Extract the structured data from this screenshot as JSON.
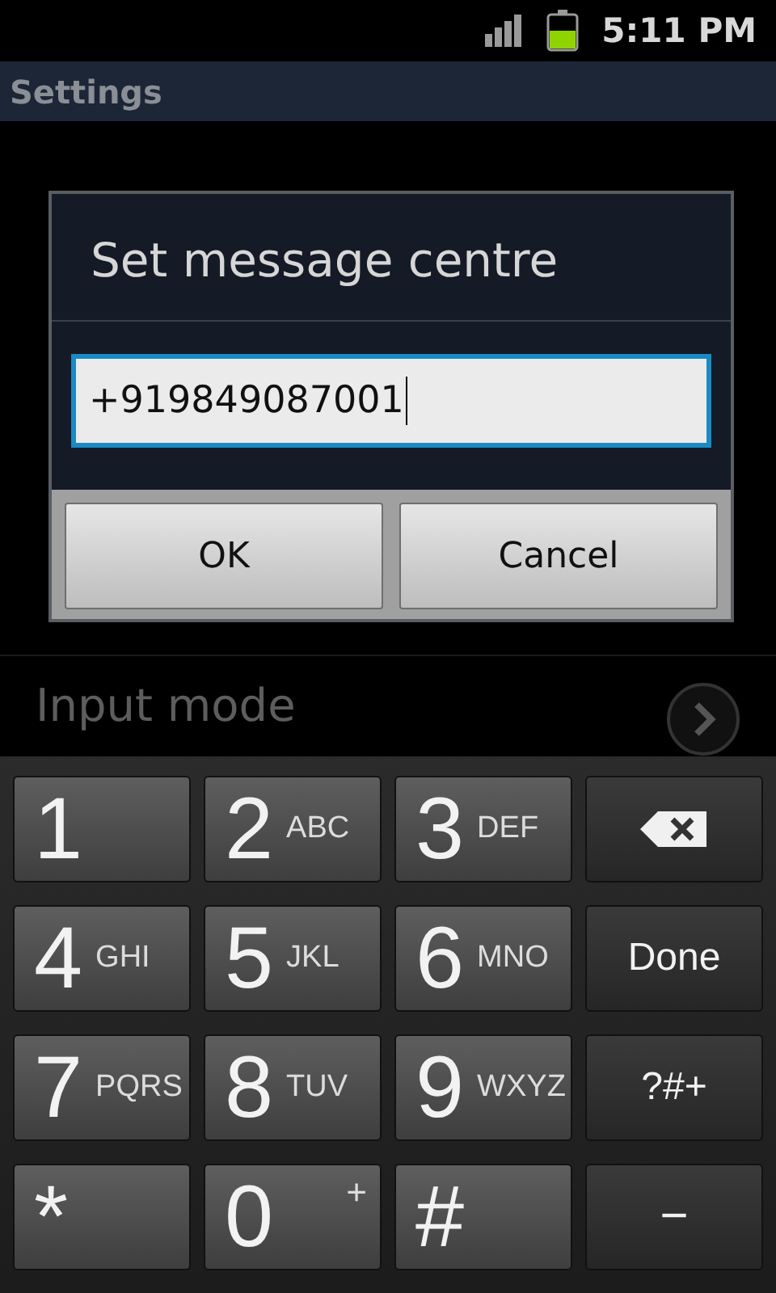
{
  "status_bar": {
    "time": "5:11 PM"
  },
  "title_bar": {
    "title": "Settings"
  },
  "settings_list": [
    {
      "title": "Input mode"
    }
  ],
  "dialog": {
    "title": "Set message centre",
    "field": {
      "value": "+919849087001"
    },
    "buttons": [
      "OK",
      "Cancel"
    ]
  },
  "keypad": [
    {
      "kind": "digit",
      "label": "1"
    },
    {
      "kind": "digit",
      "label": "2",
      "letters": "ABC"
    },
    {
      "kind": "digit",
      "label": "3",
      "letters": "DEF"
    },
    {
      "kind": "backspace"
    },
    {
      "kind": "digit",
      "label": "4",
      "letters": "GHI"
    },
    {
      "kind": "digit",
      "label": "5",
      "letters": "JKL"
    },
    {
      "kind": "digit",
      "label": "6",
      "letters": "MNO"
    },
    {
      "kind": "action",
      "label": "Done"
    },
    {
      "kind": "digit",
      "label": "7",
      "letters": "PQRS"
    },
    {
      "kind": "digit",
      "label": "8",
      "letters": "TUV"
    },
    {
      "kind": "digit",
      "label": "9",
      "letters": "WXYZ"
    },
    {
      "kind": "action",
      "label": "?#+"
    },
    {
      "kind": "digit",
      "label": "*"
    },
    {
      "kind": "digit",
      "label": "0",
      "sup": "+"
    },
    {
      "kind": "digit",
      "label": "#"
    },
    {
      "kind": "action",
      "label": "−"
    }
  ]
}
